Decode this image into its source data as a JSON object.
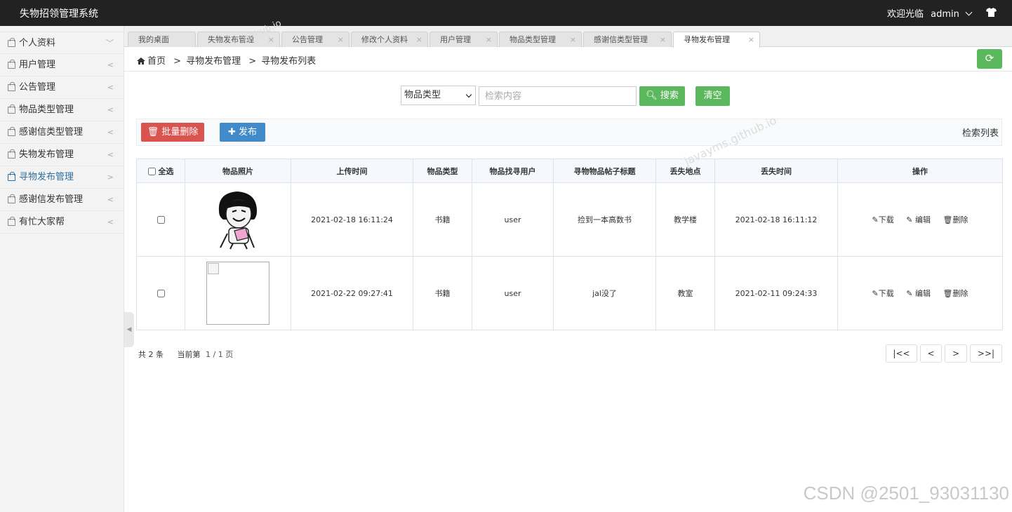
{
  "header": {
    "app_title": "失物招领管理系统",
    "welcome": "欢迎光临",
    "username": "admin"
  },
  "sidebar": {
    "items": [
      {
        "label": "个人资料"
      },
      {
        "label": "用户管理"
      },
      {
        "label": "公告管理"
      },
      {
        "label": "物品类型管理"
      },
      {
        "label": "感谢信类型管理"
      },
      {
        "label": "失物发布管理"
      },
      {
        "label": "寻物发布管理"
      },
      {
        "label": "感谢信发布管理"
      },
      {
        "label": "有忙大家帮"
      }
    ]
  },
  "tabs": [
    {
      "label": "我的桌面"
    },
    {
      "label": "失物发布管理"
    },
    {
      "label": "公告管理"
    },
    {
      "label": "修改个人资料"
    },
    {
      "label": "用户管理"
    },
    {
      "label": "物品类型管理"
    },
    {
      "label": "感谢信类型管理"
    },
    {
      "label": "寻物发布管理"
    }
  ],
  "breadcrumb": {
    "home": "首页",
    "level1": "寻物发布管理",
    "level2": "寻物发布列表",
    "separator": ">"
  },
  "search": {
    "select_value": "物品类型",
    "placeholder": "检索内容",
    "search_label": "搜索",
    "clear_label": "清空"
  },
  "toolbar": {
    "batch_delete_label": "批量删除",
    "publish_label": "发布",
    "list_label": "检索列表"
  },
  "table": {
    "headers": {
      "select_all": "全选",
      "photo": "物品照片",
      "upload_time": "上传时间",
      "item_type": "物品类型",
      "finder_user": "物品找寻用户",
      "post_title": "寻物物品帖子标题",
      "lost_place": "丢失地点",
      "lost_time": "丢失时间",
      "actions": "操作"
    },
    "rows": [
      {
        "upload_time": "2021-02-18 16:11:24",
        "item_type": "书籍",
        "user": "user",
        "title": "捡到一本高数书",
        "place": "教学楼",
        "lost_time": "2021-02-18 16:11:12"
      },
      {
        "upload_time": "2021-02-22 09:27:41",
        "item_type": "书籍",
        "user": "user",
        "title": "jal没了",
        "place": "教室",
        "lost_time": "2021-02-11 09:24:33"
      }
    ],
    "actions": {
      "download": "下载",
      "edit": "编辑",
      "delete": "删除"
    }
  },
  "pagination": {
    "total": "共 2 条",
    "current_label": "当前第",
    "current": "1 / 1 页",
    "first": "|<<",
    "prev": "<",
    "next": ">",
    "last": ">>|"
  },
  "watermarks": {
    "csdn": "CSDN @2501_93031130",
    "site": "javayms.github.io",
    "site_short": "github.io"
  },
  "colors": {
    "topbar": "#222222",
    "success": "#5cb85c",
    "danger": "#d9534f",
    "primary": "#428bca",
    "active_nav": "#2d6e9e"
  }
}
